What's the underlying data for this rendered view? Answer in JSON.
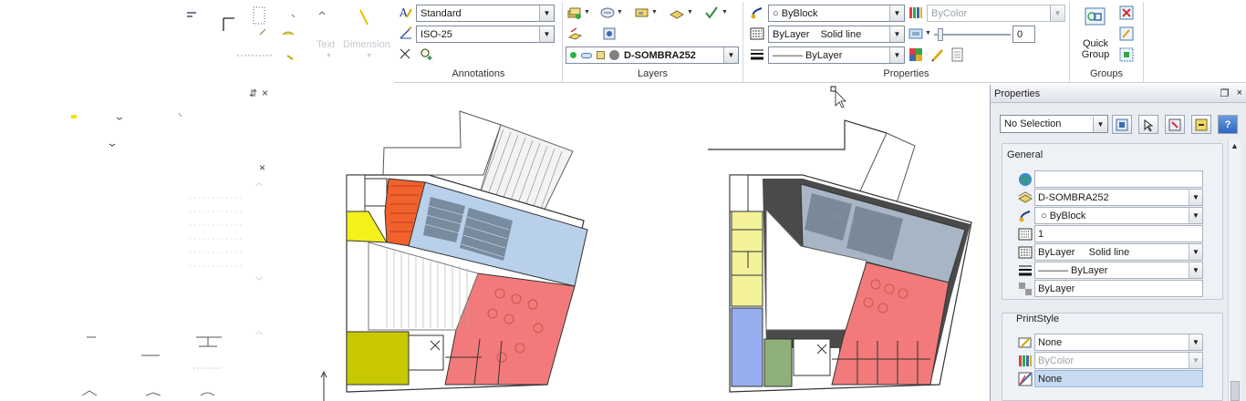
{
  "annotations": {
    "text_style": "Standard",
    "dim_style": "ISO-25",
    "text_label": "Text",
    "dimension_label": "Dimension",
    "panel_label": "Annotations"
  },
  "layers": {
    "current_layer": "D-SOMBRA252",
    "panel_label": "Layers"
  },
  "properties_panel": {
    "color": "ByBlock",
    "linetype": "ByLayer    Solid line",
    "lineweight": "——— ByLayer",
    "plot_style": "ByColor",
    "transparency": "0",
    "panel_label": "Properties"
  },
  "groups": {
    "quick_group_line1": "Quick",
    "quick_group_line2": "Group",
    "panel_label": "Groups"
  },
  "left_panel": {
    "title_fragment": "……",
    "close": "×",
    "pin": "⁄"
  },
  "palette": {
    "title": "Properties",
    "pin_glyph": "❐",
    "close_glyph": "×",
    "selection": "No Selection",
    "general_label": "General",
    "general_rows": [
      {
        "icon": "globe-icon",
        "value": "",
        "dropdown": false
      },
      {
        "icon": "layer-icon",
        "value": "D-SOMBRA252",
        "dropdown": true
      },
      {
        "icon": "color-icon",
        "value": "○ ByBlock",
        "dropdown": true
      },
      {
        "icon": "scale-icon",
        "value": "1",
        "dropdown": false
      },
      {
        "icon": "linetype-icon",
        "value": "ByLayer     Solid line",
        "dropdown": true
      },
      {
        "icon": "lineweight-icon",
        "value": "——— ByLayer",
        "dropdown": true
      },
      {
        "icon": "transparency-icon",
        "value": "ByLayer",
        "dropdown": false
      }
    ],
    "printstyle_label": "PrintStyle",
    "printstyle_rows": [
      {
        "icon": "plotstyle-icon",
        "value": "None",
        "dropdown": true
      },
      {
        "icon": "plotcolor-icon",
        "value": "ByColor",
        "dropdown": true,
        "disabled": true
      },
      {
        "icon": "plottable-icon",
        "value": "None",
        "dropdown": false,
        "highlight": true
      }
    ]
  },
  "colors": {
    "yellow_room": "#f3f01a",
    "orange_room": "#f0612c",
    "red_zone": "#f27a7a",
    "blue_zone": "#b8d0ea",
    "olive_room": "#c8c800",
    "green_room": "#8fb07a",
    "periwinkle_room": "#96aeef",
    "grey_zone": "#a8b5c4",
    "dark_corridor": "#4a4a4a"
  }
}
